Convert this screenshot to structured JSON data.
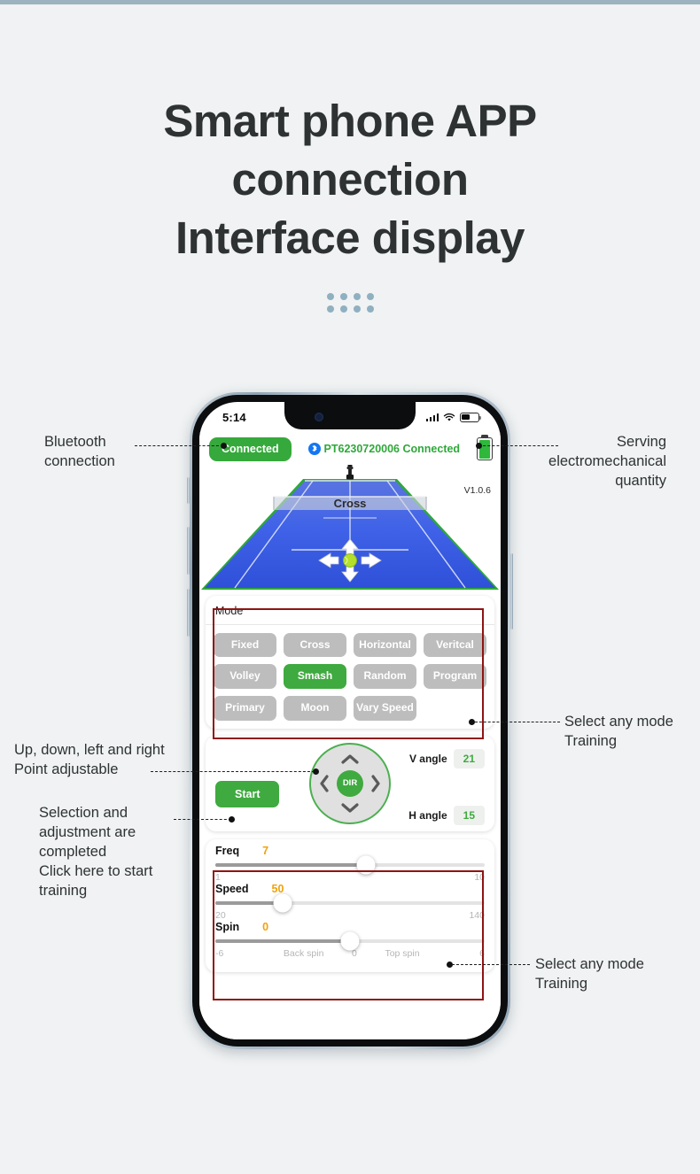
{
  "heading": {
    "line1": "Smart phone APP",
    "line2": "connection",
    "line3": "Interface display"
  },
  "phone": {
    "statusbar": {
      "time": "5:14",
      "signal_icon": "cellular-signal-icon",
      "wifi_icon": "wifi-icon",
      "battery_icon": "battery-icon"
    },
    "connection": {
      "badge_label": "Connected",
      "bluetooth_icon": "bluetooth-icon",
      "device_text": "PT6230720006 Connected",
      "battery_icon": "battery-full-icon"
    },
    "court": {
      "label": "Cross",
      "version": "V1.0.6",
      "robot_icon": "ball-machine-icon",
      "direction_icon": "four-way-arrows-icon",
      "ball_icon": "tennis-ball-icon"
    },
    "mode": {
      "title": "Mode",
      "buttons": [
        {
          "label": "Fixed",
          "active": false
        },
        {
          "label": "Cross",
          "active": false
        },
        {
          "label": "Horizontal",
          "active": false
        },
        {
          "label": "Veritcal",
          "active": false
        },
        {
          "label": "Volley",
          "active": false
        },
        {
          "label": "Smash",
          "active": true
        },
        {
          "label": "Random",
          "active": false
        },
        {
          "label": "Program",
          "active": false
        },
        {
          "label": "Primary",
          "active": false
        },
        {
          "label": "Moon",
          "active": false
        },
        {
          "label": "Vary Speed",
          "active": false
        }
      ]
    },
    "controls": {
      "start_label": "Start",
      "dir_label": "DIR",
      "v_angle_label": "V angle",
      "v_angle_value": "21",
      "h_angle_label": "H angle",
      "h_angle_value": "15",
      "up_icon": "chevron-up-icon",
      "down_icon": "chevron-down-icon",
      "left_icon": "chevron-left-icon",
      "right_icon": "chevron-right-icon"
    },
    "sliders": [
      {
        "name": "Freq",
        "value": "7",
        "min": "1",
        "max": "10",
        "percent": 56
      },
      {
        "name": "Speed",
        "value": "50",
        "min": "20",
        "max": "140",
        "percent": 25
      },
      {
        "name": "Spin",
        "value": "0",
        "min": "-6",
        "max": "6",
        "percent": 50,
        "mid_left": "Back spin",
        "mid_center": "0",
        "mid_right": "Top spin"
      }
    ]
  },
  "annotations": {
    "bluetooth": "Bluetooth\nconnection",
    "serving": "Serving\nelectromechanical\nquantity",
    "point": "Up, down, left and right\nPoint adjustable",
    "start": "Selection and\nadjustment are\ncompleted\nClick here to start\ntraining",
    "mode_right": "Select any mode\nTraining",
    "slider_right": "Select any mode\nTraining"
  },
  "colors": {
    "accent_green": "#3faa3f",
    "highlight_red": "#8f1414",
    "slider_value": "#f0a30a",
    "page_bg": "#f0f2f3",
    "top_strip": "#9cb4bf"
  }
}
